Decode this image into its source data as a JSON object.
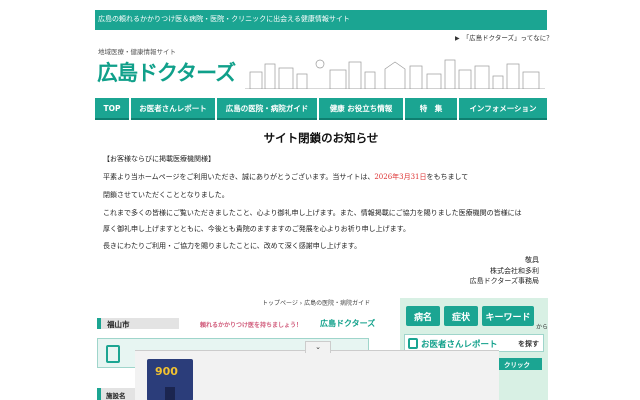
{
  "header": {
    "tagline": "広島の頼れるかかりつけ医＆病院・医院・クリニックに出会える健康情報サイト",
    "about_link": "「広島ドクターズ」ってなに？",
    "logo_sub": "地域医療・健康情報サイト",
    "logo_main": "広島ドクターズ"
  },
  "nav": {
    "items": [
      {
        "label": "TOP"
      },
      {
        "label": "お医者さんレポート"
      },
      {
        "label": "広島の医院・病院ガイド"
      },
      {
        "label": "健康 お役立ち情報"
      },
      {
        "label": "特　集"
      },
      {
        "label": "インフォメーション"
      }
    ]
  },
  "notice": {
    "title": "サイト閉鎖のお知らせ",
    "heading": "【お客様ならびに掲載医療機関様】",
    "line1_pre": "平素より当ホームページをご利用いただき、誠にありがとうございます。当サイトは、",
    "line1_date": "2026年3月31日",
    "line1_post": "をもちまして",
    "line2": "閉鎖させていただくこととなりました。",
    "line3": "これまで多くの皆様にご覧いただきましたこと、心より御礼申し上げます。また、情報掲載にご協力を賜りました医療機関の皆様には",
    "line4": "厚く御礼申し上げますとともに、今後とも貴院のますますのご発展を心よりお祈り申し上げます。",
    "line5": "長きにわたりご利用・ご協力を賜りましたことに、改めて深く感謝申し上げます。",
    "sign1": "敬具",
    "sign2": "株式会社和多利",
    "sign3": "広島ドクターズ事務局"
  },
  "breadcrumb": "トップページ › 広島の医院・病院ガイド",
  "city_label": "福山市",
  "banner_small": {
    "lead": "頼れるかかりつけ医を持ちましょう！",
    "brand": "広島ドクターズ"
  },
  "facility_label": "施設名",
  "side_banner": {
    "tag1": "病名",
    "tag2": "症状",
    "tag3": "キーワード",
    "kara": "から",
    "report_label": "お医者さんレポート",
    "report_suffix": "を探す",
    "click_label": "クリック"
  },
  "ad": {
    "collapse_icon": "chevron-down-icon",
    "product_badge": "900"
  }
}
